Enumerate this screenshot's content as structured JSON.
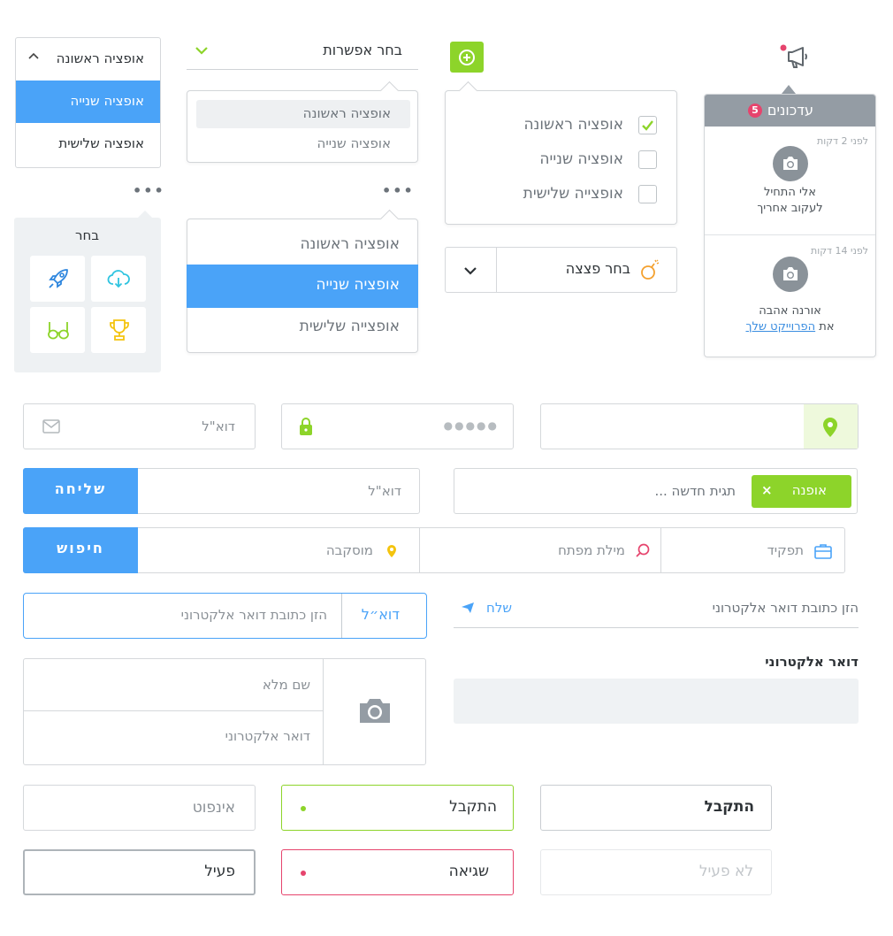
{
  "dropdown1": {
    "selected": "אופציה ראשונה",
    "items": [
      "אופציה שנייה",
      "אופציה שלישית"
    ]
  },
  "dropdown2": {
    "label": "בחר אפשרות",
    "items": [
      "אופציה ראשונה",
      "אופציה שנייה"
    ]
  },
  "checklist": {
    "items": [
      "אופציה ראשונה",
      "אופציה שנייה",
      "אופצייה שלישית"
    ],
    "checked": [
      true,
      false,
      false
    ]
  },
  "notifications": {
    "title": "עדכונים",
    "badge": "5",
    "items": [
      {
        "time": "לפני 2 דקות",
        "line1": "אלי התחיל",
        "line2": "לעקוב אחריך"
      },
      {
        "time": "לפני 14 דקות",
        "line1": "אורנה אהבה",
        "line2_prefix": "את",
        "line2_link": "הפרוייקט שלך"
      }
    ]
  },
  "icon_picker": {
    "title": "בחר",
    "icons": [
      "cloud-icon",
      "rocket-icon",
      "trophy-icon",
      "glasses-icon"
    ]
  },
  "menu_list": {
    "items": [
      "אופציה ראשונה",
      "אופציה שנייה",
      "אופצייה שלישית"
    ],
    "active_index": 1
  },
  "pizza_select": {
    "label": "בחר פצצה"
  },
  "inputs": {
    "email_placeholder": "דוא\"ל",
    "password_dots": "●●●●●",
    "send_button": "שליחה",
    "tag_chip": "אופנה",
    "tag_placeholder": "תגית חדשה ...",
    "job_placeholder": "תפקיד",
    "keyword_placeholder": "מילת מפתח",
    "location_placeholder": "מוסקבה",
    "search_button": "חיפוש",
    "email_label": "דוא״ל",
    "email_address_placeholder": "הזן כתובת דואר אלקטרוני",
    "send_link": "שלח",
    "email_section_label": "דואר אלקטרוני",
    "fullname_placeholder": "שם מלא",
    "email_field_placeholder": "דואר אלקטרוני"
  },
  "states": {
    "accepted_bold": "התקבל",
    "accepted": "התקבל",
    "input": "אינפוט",
    "disabled": "לא פעיל",
    "error": "שגיאה",
    "active": "פעיל"
  },
  "colors": {
    "green": "#8dd42a",
    "blue": "#4aa3f8",
    "red": "#e6446d",
    "gray_header": "#949ca4",
    "orange": "#f4a12f",
    "yellow": "#f4c40f",
    "teal": "#2fc4e0"
  }
}
